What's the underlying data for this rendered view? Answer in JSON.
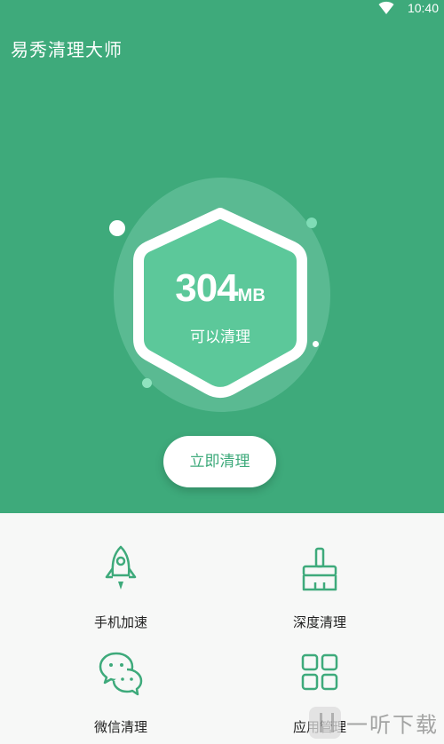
{
  "status_bar": {
    "time": "10:40",
    "wifi_icon": "wifi-icon"
  },
  "header": {
    "title": "易秀清理大师"
  },
  "cleanup": {
    "amount": "304",
    "unit": "MB",
    "caption": "可以清理",
    "button_label": "立即清理"
  },
  "tools": [
    {
      "label": "手机加速",
      "icon": "rocket-icon"
    },
    {
      "label": "深度清理",
      "icon": "brush-icon"
    },
    {
      "label": "微信清理",
      "icon": "wechat-icon"
    },
    {
      "label": "应用管理",
      "icon": "grid-icon"
    }
  ],
  "watermark": {
    "text": "一听下载"
  },
  "colors": {
    "primary": "#3eaa7b",
    "shield": "#5cc89a",
    "background": "#f7f8f7"
  }
}
